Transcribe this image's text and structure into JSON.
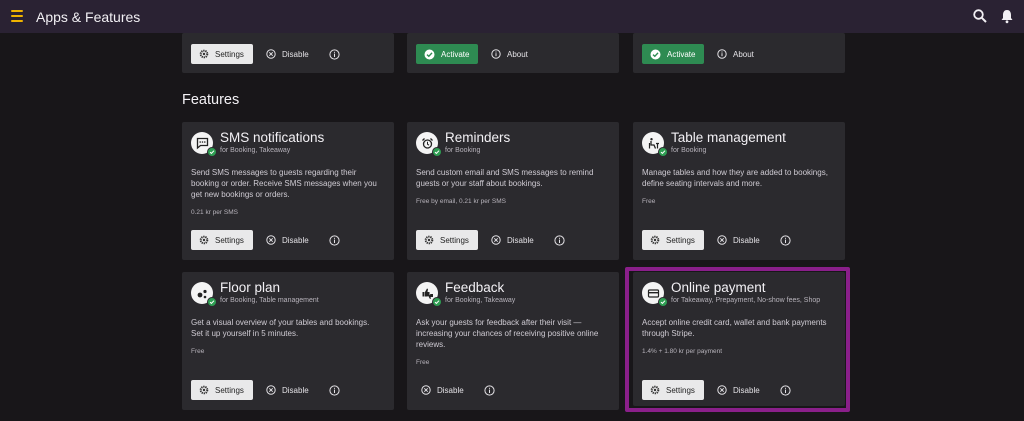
{
  "app": {
    "title": "Apps & Features"
  },
  "top_row": [
    {
      "primary_label": "Settings",
      "secondary_label": "Disable"
    },
    {
      "primary_label": "Activate",
      "secondary_label": "About"
    },
    {
      "primary_label": "Activate",
      "secondary_label": "About"
    }
  ],
  "features_section": {
    "title": "Features"
  },
  "features": [
    {
      "title": "SMS notifications",
      "subtitle": "for Booking, Takeaway",
      "description": "Send SMS messages to guests regarding their booking or order. Receive SMS messages when you get new bookings or orders.",
      "price": "0.21 kr per SMS",
      "icon": "chat-icon",
      "settings_label": "Settings",
      "disable_label": "Disable"
    },
    {
      "title": "Reminders",
      "subtitle": "for Booking",
      "description": "Send custom email and SMS messages to remind guests or your staff about bookings.",
      "price": "Free by email, 0.21 kr per SMS",
      "icon": "alarm-icon",
      "settings_label": "Settings",
      "disable_label": "Disable"
    },
    {
      "title": "Table management",
      "subtitle": "for Booking",
      "description": "Manage tables and how they are added to bookings, define seating intervals and more.",
      "price": "Free",
      "icon": "table-chair-icon",
      "settings_label": "Settings",
      "disable_label": "Disable"
    },
    {
      "title": "Floor plan",
      "subtitle": "for Booking, Table management",
      "description": "Get a visual overview of your tables and bookings. Set it up yourself in 5 minutes.",
      "price": "Free",
      "icon": "floor-plan-icon",
      "settings_label": "Settings",
      "disable_label": "Disable"
    },
    {
      "title": "Feedback",
      "subtitle": "for Booking, Takeaway",
      "description": "Ask your guests for feedback after their visit — increasing your chances of receiving positive online reviews.",
      "price": "Free",
      "icon": "thumbs-icon",
      "disable_label": "Disable"
    },
    {
      "title": "Online payment",
      "subtitle": "for Takeaway, Prepayment, No-show fees, Shop",
      "description": "Accept online credit card, wallet and bank payments through Stripe.",
      "price": "1.4% + 1.80 kr per payment",
      "icon": "credit-card-icon",
      "settings_label": "Settings",
      "disable_label": "Disable"
    }
  ],
  "colors": {
    "topbar": "#2a2233",
    "background": "#181619",
    "card": "#2b2a2e",
    "accent_menu": "#f0b400",
    "activate_green": "#2e8b52",
    "highlight": "#8a1f8a"
  }
}
